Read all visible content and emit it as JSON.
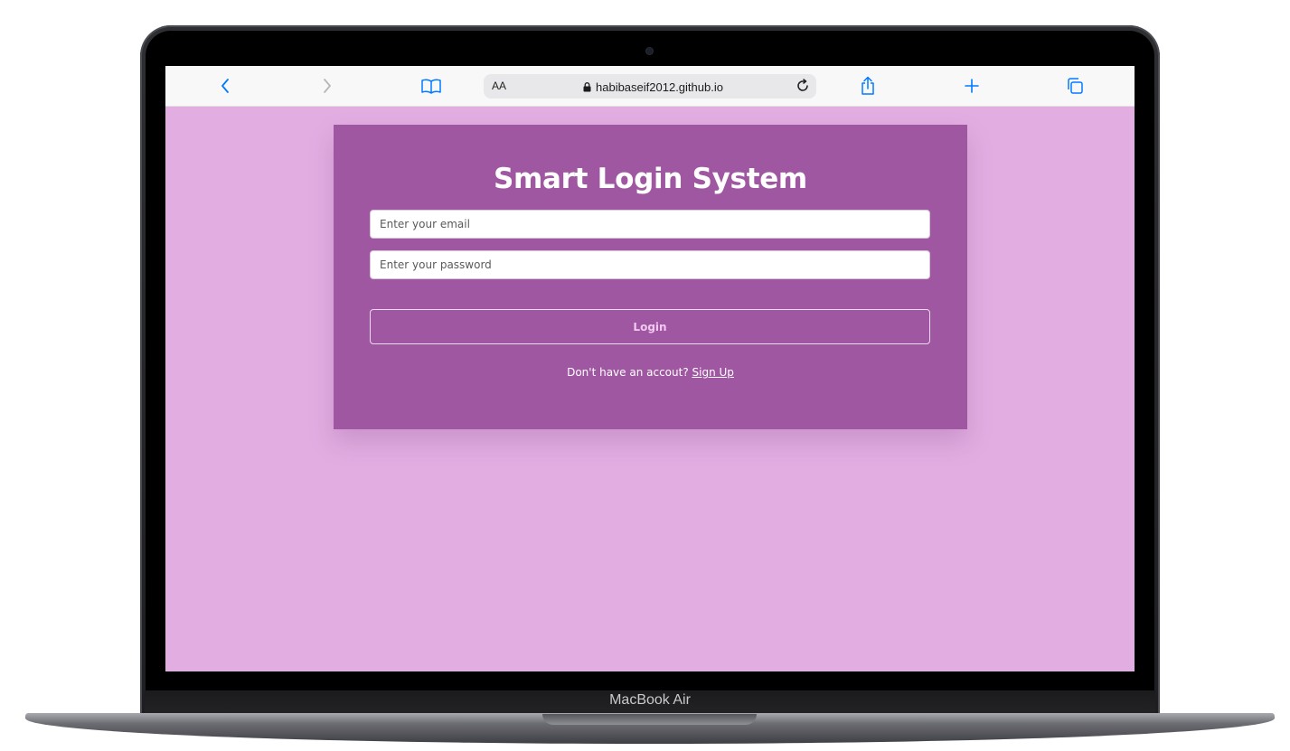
{
  "device": {
    "model_label": "MacBook Air"
  },
  "browser": {
    "text_size_label": "AA",
    "url": "habibaseif2012.github.io",
    "icons": {
      "back": "chevron-left-icon",
      "forward": "chevron-right-icon",
      "bookmarks": "book-icon",
      "secure": "lock-icon",
      "reload": "reload-icon",
      "share": "share-icon",
      "new_tab": "plus-icon",
      "tabs": "tabs-icon"
    },
    "accent_color": "#007aff"
  },
  "login_form": {
    "title": "Smart Login System",
    "email_placeholder": "Enter your email",
    "password_placeholder": "Enter your password",
    "login_label": "Login",
    "signup_prompt": "Don't have an accout?",
    "signup_link": "Sign Up"
  },
  "colors": {
    "page_background": "#e2aee2",
    "card_background": "#a057a2"
  }
}
